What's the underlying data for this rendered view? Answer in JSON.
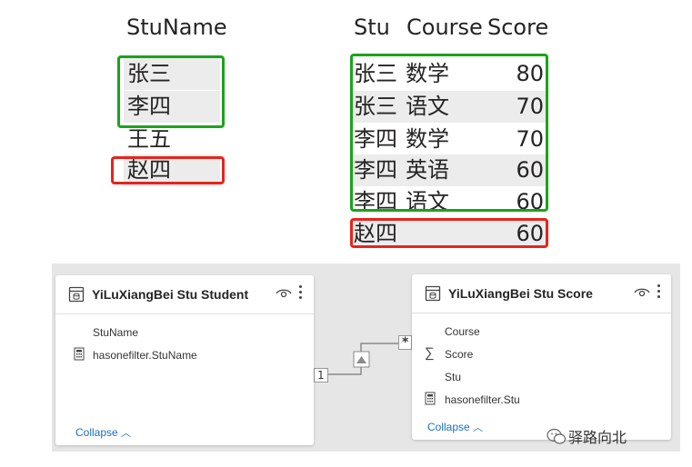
{
  "student_table": {
    "header": "StuName",
    "rows": [
      "张三",
      "李四",
      "王五",
      "赵四"
    ]
  },
  "score_table": {
    "headers": {
      "stu": "Stu",
      "course": "Course",
      "score": "Score"
    },
    "rows": [
      {
        "stu": "张三",
        "course": "数学",
        "score": "80"
      },
      {
        "stu": "张三",
        "course": "语文",
        "score": "70"
      },
      {
        "stu": "李四",
        "course": "数学",
        "score": "70"
      },
      {
        "stu": "李四",
        "course": "英语",
        "score": "60"
      },
      {
        "stu": "李四",
        "course": "语文",
        "score": "60"
      },
      {
        "stu": "赵四",
        "course": "",
        "score": "60"
      }
    ]
  },
  "highlight_colors": {
    "match": "#1aa31a",
    "unmatched": "#e8231c"
  },
  "model": {
    "student_card": {
      "title": "YiLuXiangBei Stu Student",
      "fields": [
        "StuName",
        "hasonefilter.StuName"
      ],
      "collapse": "Collapse"
    },
    "score_card": {
      "title": "YiLuXiangBei Stu Score",
      "fields": [
        "Course",
        "Score",
        "Stu",
        "hasonefilter.Stu"
      ],
      "collapse": "Collapse"
    },
    "relationship": {
      "one_side": "1",
      "many_side": "*"
    }
  },
  "watermark": "驿路向北"
}
